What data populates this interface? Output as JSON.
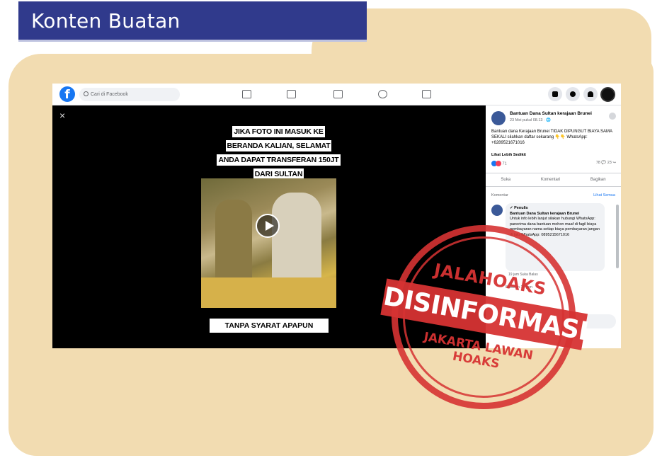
{
  "banner": {
    "title": "Konten Buatan"
  },
  "colors": {
    "banner_bg": "#303a8c",
    "folder_bg": "#f2dcb1",
    "stamp_red": "#d63333",
    "facebook_blue": "#1877f2"
  },
  "facebook": {
    "logo": "f",
    "search_placeholder": "Cari di Facebook",
    "nav_icons": [
      "home-icon",
      "watch-icon",
      "marketplace-icon",
      "groups-icon",
      "gaming-icon"
    ],
    "right_icons": [
      "menu-grid-icon",
      "messenger-icon",
      "notifications-icon",
      "profile-avatar"
    ],
    "video": {
      "close": "×",
      "caption_top": "JIKA FOTO INI MASUK KE BERANDA KALIAN, SELAMAT ANDA DAPAT TRANSFERAN 150JT DARI SULTAN",
      "caption_bottom": "TANPA SYARAT APAPUN"
    },
    "post": {
      "author": "Bantuan Dana Sultan kerajaan Brunei",
      "time": "23 Mei pukul 08.13 · 🌐",
      "body": "Bantuan dana Kerajaan Brunei TIDAK DIPUNGUT BIAYA SAMA SEKALI silahkan daftar sekarang 👇👇 WhatsApp: +6289521671016",
      "see_more": "Lihat Lebih Sedikit",
      "reaction_count": "71",
      "stats": "78 💬  23 ↪",
      "actions": [
        "Suka",
        "Komentari",
        "Bagikan"
      ],
      "sort": "Komentar",
      "see_all": "Lihat Semua"
    },
    "comment": {
      "badge": "✓ Penulis",
      "author": "Bantuan Dana Sultan kerajaan Brunei",
      "text": "Untuk info lebih lanjut silakan hubungi WhatsApp: panerima dana bantuan mohon maaf di fagil biaya pembayaran nama setiap biaya pembayaran jangan di lalu WhatsApp: 0895215671016",
      "meta": "19 jam   Suka   Balas",
      "reply_line": "Balasan   15 jam",
      "input_placeholder": "Tulis komentar publik..."
    }
  },
  "stamp": {
    "top": "JALAHOAKS",
    "band": "DISINFORMASI",
    "bottom": "JAKARTA LAWAN HOAKS"
  }
}
